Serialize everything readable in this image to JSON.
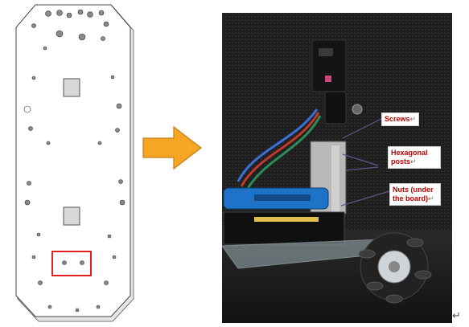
{
  "labels": {
    "screws": "Screws",
    "hex_posts": "Hexagonal posts",
    "nuts": "Nuts (under the board)"
  },
  "paragraph_mark": "↵",
  "colors": {
    "label_text": "#c00000",
    "highlight_box": "#e02020",
    "arrow": "#f5a623",
    "arrow_stroke": "#c97d14"
  },
  "icons": {
    "arrow": "arrow-right-icon",
    "paragraph_mark": "return-icon"
  }
}
